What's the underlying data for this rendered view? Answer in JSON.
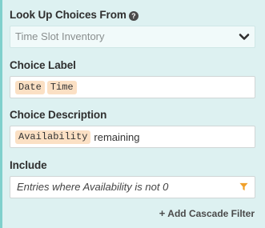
{
  "lookup": {
    "label": "Look Up Choices From",
    "help_icon": "question-circle-icon",
    "selected": "Time Slot Inventory"
  },
  "choice_label": {
    "label": "Choice Label",
    "chips": [
      "Date",
      "Time"
    ]
  },
  "choice_description": {
    "label": "Choice Description",
    "chip": "Availability",
    "text": "remaining"
  },
  "include": {
    "label": "Include",
    "value": "Entries where Availability is not 0",
    "filter_color": "#f0a02a"
  },
  "cascade": {
    "plus": "+",
    "label": "Add Cascade Filter"
  }
}
